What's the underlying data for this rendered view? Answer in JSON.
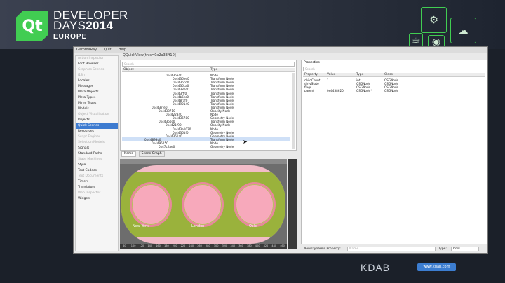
{
  "slide": {
    "brand": "Qt",
    "title_line1": "DEVELOPER",
    "title_line2_prefix": "DAYS",
    "title_line2_year": "2014",
    "region": "EUROPE",
    "footer_brand": "KDAB",
    "footer_url": "www.kdab.com"
  },
  "app": {
    "menus": [
      "GammaRay",
      "Quit",
      "Help"
    ],
    "window_title": "QQuickView[this=0x2a33ff10]"
  },
  "sidebar": {
    "items": [
      {
        "label": "Action Inspector",
        "muted": true
      },
      {
        "label": "Font Browser",
        "muted": false
      },
      {
        "label": "Graphics Scenes",
        "muted": true
      },
      {
        "label": "i18n",
        "muted": true
      },
      {
        "label": "Locales",
        "muted": false
      },
      {
        "label": "Messages",
        "muted": false
      },
      {
        "label": "Meta Objects",
        "muted": false
      },
      {
        "label": "Meta Types",
        "muted": false
      },
      {
        "label": "Mime Types",
        "muted": false
      },
      {
        "label": "Models",
        "muted": false
      },
      {
        "label": "Object Visualization",
        "muted": true
      },
      {
        "label": "Objects",
        "muted": false
      },
      {
        "label": "Quick Scenes",
        "muted": false,
        "selected": true
      },
      {
        "label": "Resources",
        "muted": false
      },
      {
        "label": "Script Engines",
        "muted": true
      },
      {
        "label": "Selection Models",
        "muted": true
      },
      {
        "label": "Signals",
        "muted": false
      },
      {
        "label": "Standard Paths",
        "muted": false
      },
      {
        "label": "State Machines",
        "muted": true
      },
      {
        "label": "Style",
        "muted": false
      },
      {
        "label": "Text Codecs",
        "muted": false
      },
      {
        "label": "Text Documents",
        "muted": true
      },
      {
        "label": "Timers",
        "muted": false
      },
      {
        "label": "Translators",
        "muted": false
      },
      {
        "label": "Web Inspector",
        "muted": true
      },
      {
        "label": "Widgets",
        "muted": false
      }
    ]
  },
  "object_tree": {
    "search_placeholder": "Search",
    "col_object": "Object",
    "col_type": "Type",
    "rows": [
      {
        "object": "0x4436a40",
        "type": "Node",
        "indent": 3
      },
      {
        "object": "0x4436ee0",
        "type": "Transform Node",
        "indent": 4
      },
      {
        "object": "0x4436cd0",
        "type": "Transform Node",
        "indent": 4
      },
      {
        "object": "0x4436ca0",
        "type": "Transform Node",
        "indent": 4
      },
      {
        "object": "0x44380d0",
        "type": "Transform Node",
        "indent": 4
      },
      {
        "object": "0x443fff0",
        "type": "Transform Node",
        "indent": 4
      },
      {
        "object": "0x44b6cc0",
        "type": "Transform Node",
        "indent": 4
      },
      {
        "object": "0x448f1f0",
        "type": "Transform Node",
        "indent": 4
      },
      {
        "object": "0x4492140",
        "type": "Transform Node",
        "indent": 4
      },
      {
        "object": "0x4437fe0",
        "type": "Transform Node",
        "indent": 1
      },
      {
        "object": "0x4438710",
        "type": "Opacity Node",
        "indent": 2
      },
      {
        "object": "0x4422840",
        "type": "Node",
        "indent": 3
      },
      {
        "object": "0x4436780",
        "type": "Geometry Node",
        "indent": 4
      },
      {
        "object": "0x44360c0",
        "type": "Transform Node",
        "indent": 2
      },
      {
        "object": "0x4421f90",
        "type": "Opacity Node",
        "indent": 3
      },
      {
        "object": "0x443e1020",
        "type": "Node",
        "indent": 4
      },
      {
        "object": "0x4436df0",
        "type": "Geometry Node",
        "indent": 4
      },
      {
        "object": "0x44361a0",
        "type": "Geometry Node",
        "indent": 3
      },
      {
        "object": "0x44893c0",
        "type": "Transform Node",
        "indent": 0,
        "selected": true
      },
      {
        "object": "0x4495250",
        "type": "Node",
        "indent": 1
      },
      {
        "object": "0x47c2ae0",
        "type": "Geometry Node",
        "indent": 2
      }
    ]
  },
  "tabs": [
    "Items",
    "Scene Graph"
  ],
  "scene": {
    "clocks": [
      "New York",
      "London",
      "Oslo"
    ],
    "ruler_ticks": [
      "80",
      "100",
      "120",
      "140",
      "160",
      "180",
      "200",
      "220",
      "240",
      "260",
      "280",
      "300",
      "320",
      "340",
      "360",
      "380",
      "400",
      "420",
      "440",
      "460"
    ]
  },
  "properties": {
    "title": "Properties",
    "search_placeholder": "Search",
    "headers": [
      "Property",
      "Value",
      "Type",
      "Class"
    ],
    "rows": [
      {
        "property": "childCount",
        "value": "1",
        "type": "int",
        "class": "QSGNode"
      },
      {
        "property": "dirtyState",
        "value": "",
        "type": "QSGNode",
        "class": "QSGNode"
      },
      {
        "property": "flags",
        "value": "",
        "type": "QSGNode",
        "class": "QSGNode"
      },
      {
        "property": "parent",
        "value": "0x4438620",
        "type": "QSGNode*",
        "class": "QSGNode"
      }
    ]
  },
  "dynamic_property": {
    "label": "New Dynamic Property:",
    "name_placeholder": "Name",
    "type_label": "Type:",
    "type_value": "bool"
  },
  "colors": {
    "qt_green": "#41cd52",
    "selection": "#3d7bd0",
    "stage_pink": "#f2bcc8",
    "stage_green": "#9ab23c"
  }
}
